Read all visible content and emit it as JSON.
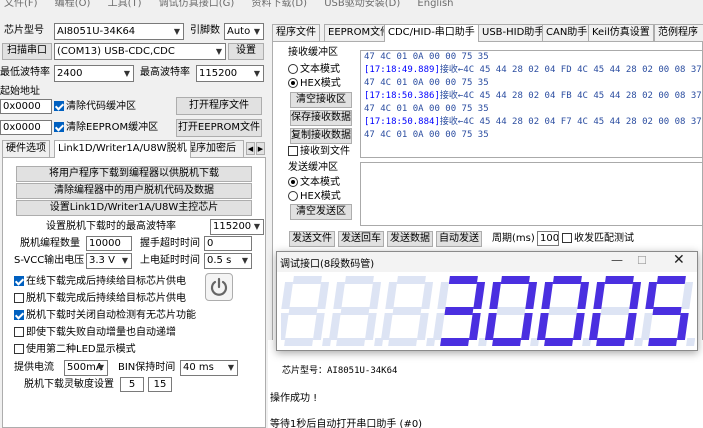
{
  "menu": [
    "文件(F)",
    "编程(O)",
    "工具(T)",
    "调试仿真接口(G)",
    "资料下载(D)",
    "USB驱动安装(D)",
    "English"
  ],
  "left": {
    "chip_label": "芯片型号",
    "chip_value": "AI8051U-34K64",
    "pin_label": "引脚数",
    "pin_value": "Auto",
    "scan_button": "扫描串口",
    "port_value": "(COM13) USB-CDC,CDC",
    "settings_button": "设置",
    "min_baud_label": "最低波特率",
    "min_baud_value": "2400",
    "max_baud_label": "最高波特率",
    "max_baud_value": "115200",
    "start_addr_label": "起始地址",
    "addr1_value": "0x0000",
    "clear_code_label": "清除代码缓冲区",
    "open_program_button": "打开程序文件",
    "addr2_value": "0x0000",
    "clear_eeprom_label": "清除EEPROM缓冲区",
    "open_eeprom_button": "打开EEPROM文件",
    "tabs": [
      "硬件选项",
      "Link1D/Writer1A/U8W脱机",
      "程序加密后"
    ],
    "btn_download_offline": "将用户程序下载到编程器以供脱机下载",
    "btn_clear_offline": "清除编程器中的用户脱机代码及数据",
    "btn_set_master": "设置Link1D/Writer1A/U8W主控芯片",
    "max_offline_baud_label": "设置脱机下载时的最高波特率",
    "max_offline_baud_value": "115200",
    "offline_count_label": "脱机编程数量",
    "offline_count_value": "10000",
    "handshake_timeout_label": "握手超时时间",
    "handshake_timeout_value": "0",
    "svcc_label": "S-VCC输出电压",
    "svcc_value": "3.3 V",
    "powerup_delay_label": "上电延时时间",
    "powerup_delay_value": "0.5 s",
    "opt1": "在线下载完成后持续给目标芯片供电",
    "opt2": "脱机下载完成后持续给目标芯片供电",
    "opt3": "脱机下载时关闭自动检测有无芯片功能",
    "opt4": "即使下载失败自动增量也自动递增",
    "opt5": "使用第二种LED显示模式",
    "supply_current_label": "提供电流",
    "supply_current_value": "500mA",
    "bin_hold_label": "BIN保持时间",
    "bin_hold_value": "40 ms",
    "sensitivity_label": "脱机下载灵敏度设置",
    "sensitivity_a": "5",
    "sensitivity_b": "15"
  },
  "right": {
    "tabs": [
      "程序文件",
      "EEPROM文件",
      "CDC/HID-串口助手",
      "USB-HID助手",
      "CAN助手",
      "Keil仿真设置",
      "范例程序"
    ],
    "recv_title": "接收缓冲区",
    "recv_text_mode": "文本模式",
    "recv_hex_mode": "HEX模式",
    "clear_recv_button": "清空接收区",
    "save_recv_button": "保存接收数据",
    "copy_recv_button": "复制接收数据",
    "recv_to_file": "接收到文件",
    "recv_lines": [
      {
        "ts": "",
        "text": "                         47 4C 01 0A 00 00 75 35"
      },
      {
        "ts": "[17:18:49.889]",
        "text": "接收←4C 45 44 28 02 04 FD 4C 45 44 28 02 00 08 37 53"
      },
      {
        "ts": "",
        "text": "                         47 4C 01 0A 00 00 75 35"
      },
      {
        "ts": "[17:18:50.386]",
        "text": "接收←4C 45 44 28 02 04 FB 4C 45 44 28 02 00 08 37 53"
      },
      {
        "ts": "",
        "text": "                         47 4C 01 0A 00 00 75 35"
      },
      {
        "ts": "[17:18:50.884]",
        "text": "接收←4C 45 44 28 02 04 F7 4C 45 44 28 02 00 08 37 53"
      },
      {
        "ts": "",
        "text": "                         47 4C 01 0A 00 00 75 35"
      }
    ],
    "send_title": "发送缓冲区",
    "send_text_mode": "文本模式",
    "send_hex_mode": "HEX模式",
    "clear_send_button": "清空发送区",
    "send_file_button": "发送文件",
    "send_enter_button": "发送回车",
    "send_data_button": "发送数据",
    "auto_send_button": "自动发送",
    "period_label": "周期(ms)",
    "period_value": "100",
    "match_recv_label": "收发匹配测试",
    "output_lines": [
      "芯片型号：AI8051U-34K64",
      "操作成功 !",
      "等待1秒后自动打开串口助手 (#0)"
    ]
  },
  "dialog": {
    "title": "调试接口(8段数码管)",
    "display_value": "30005",
    "digit_color": "#4a2fe0",
    "off_color": "#dde4f4"
  }
}
